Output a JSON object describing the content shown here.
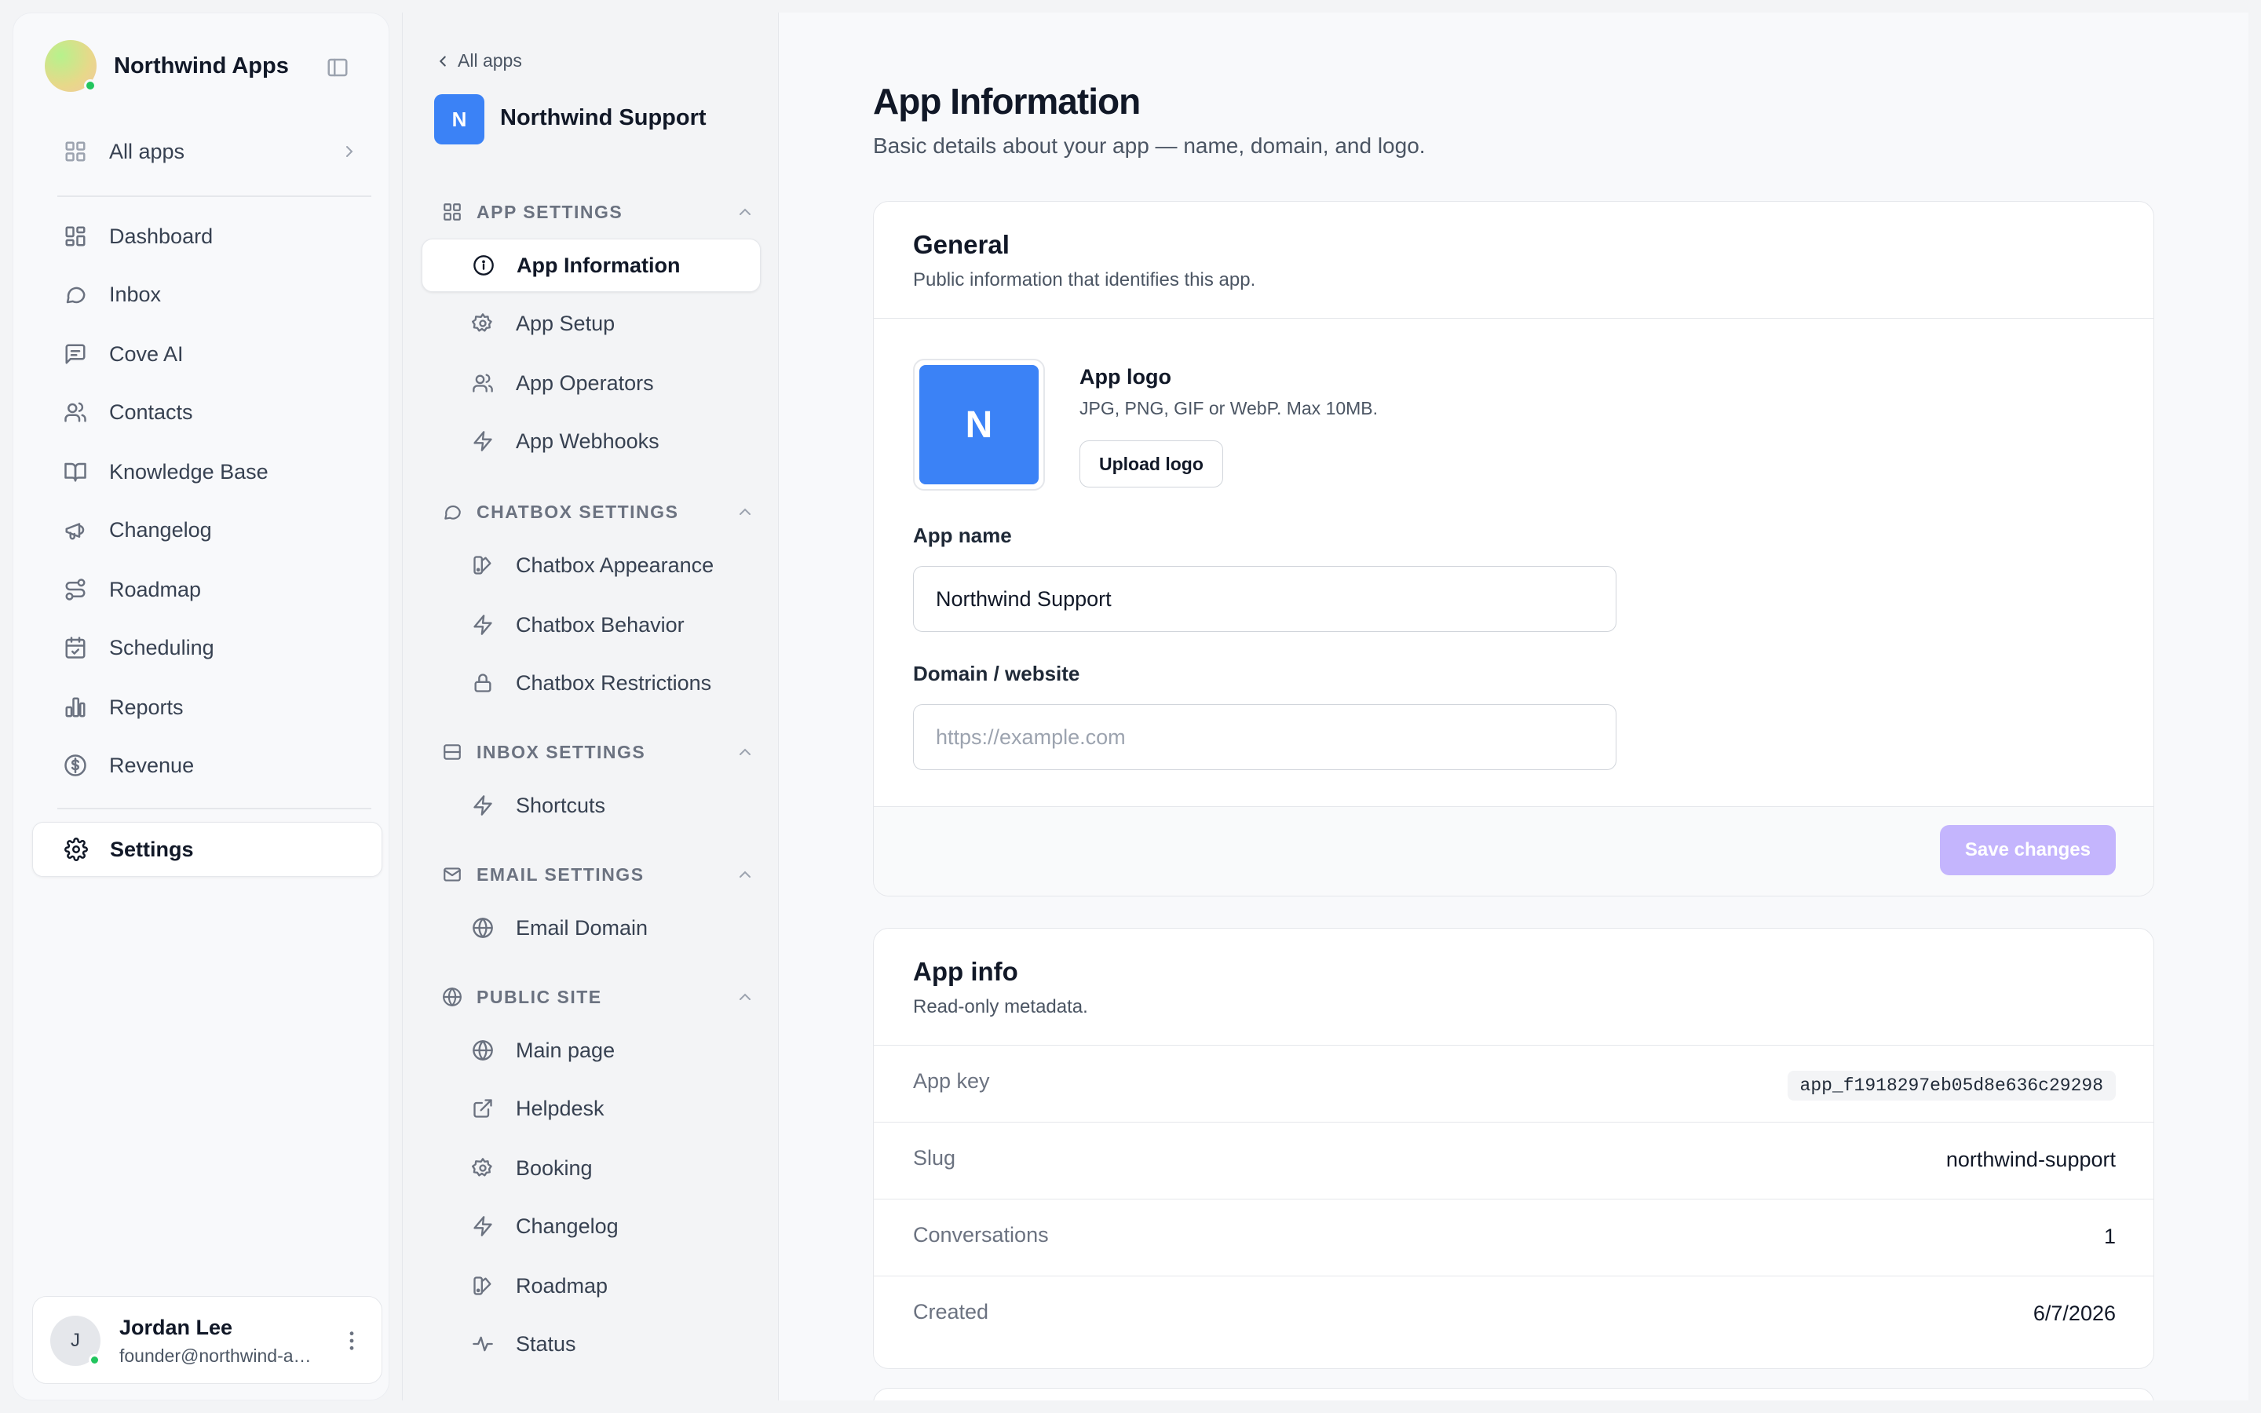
{
  "sidebar": {
    "brand": "Northwind Apps",
    "all_apps": "All apps",
    "nav": [
      {
        "label": "Dashboard",
        "icon": "dashboard-icon"
      },
      {
        "label": "Inbox",
        "icon": "chat-bubble-icon"
      },
      {
        "label": "Cove AI",
        "icon": "message-square-icon"
      },
      {
        "label": "Contacts",
        "icon": "users-icon"
      },
      {
        "label": "Knowledge Base",
        "icon": "book-open-icon"
      },
      {
        "label": "Changelog",
        "icon": "megaphone-icon"
      },
      {
        "label": "Roadmap",
        "icon": "route-icon"
      },
      {
        "label": "Scheduling",
        "icon": "calendar-check-icon"
      },
      {
        "label": "Reports",
        "icon": "bar-chart-icon"
      },
      {
        "label": "Revenue",
        "icon": "dollar-circle-icon"
      }
    ],
    "settings": "Settings",
    "user": {
      "initial": "J",
      "name": "Jordan Lee",
      "email": "founder@northwind-apps.com"
    }
  },
  "subnav": {
    "back": "All apps",
    "app_initial": "N",
    "app_name": "Northwind Support",
    "sections": {
      "app_settings": {
        "title": "APP SETTINGS",
        "items": [
          "App Information",
          "App Setup",
          "App Operators",
          "App Webhooks"
        ]
      },
      "chatbox_settings": {
        "title": "CHATBOX SETTINGS",
        "items": [
          "Chatbox Appearance",
          "Chatbox Behavior",
          "Chatbox Restrictions"
        ]
      },
      "inbox_settings": {
        "title": "INBOX SETTINGS",
        "items": [
          "Shortcuts"
        ]
      },
      "email_settings": {
        "title": "EMAIL SETTINGS",
        "items": [
          "Email Domain"
        ]
      },
      "public_site": {
        "title": "PUBLIC SITE",
        "items": [
          "Main page",
          "Helpdesk",
          "Booking",
          "Changelog",
          "Roadmap",
          "Status"
        ]
      }
    },
    "active_item": "App Information"
  },
  "main": {
    "title": "App Information",
    "subtitle": "Basic details about your app — name, domain, and logo.",
    "general": {
      "title": "General",
      "subtitle": "Public information that identifies this app.",
      "logo_initial": "N",
      "logo_label": "App logo",
      "logo_help": "JPG, PNG, GIF or WebP. Max 10MB.",
      "upload_label": "Upload logo",
      "app_name_label": "App name",
      "app_name_value": "Northwind Support",
      "domain_label": "Domain / website",
      "domain_placeholder": "https://example.com",
      "save_label": "Save changes"
    },
    "app_info": {
      "title": "App info",
      "subtitle": "Read-only metadata.",
      "rows": [
        {
          "key": "App key",
          "value": "app_f1918297eb05d8e636c29298"
        },
        {
          "key": "Slug",
          "value": "northwind-support"
        },
        {
          "key": "Conversations",
          "value": "1"
        },
        {
          "key": "Created",
          "value": "6/7/2026"
        }
      ]
    }
  },
  "colors": {
    "accent": "#3b82f6",
    "save_disabled": "#c4b5fd",
    "online": "#22c55e"
  }
}
